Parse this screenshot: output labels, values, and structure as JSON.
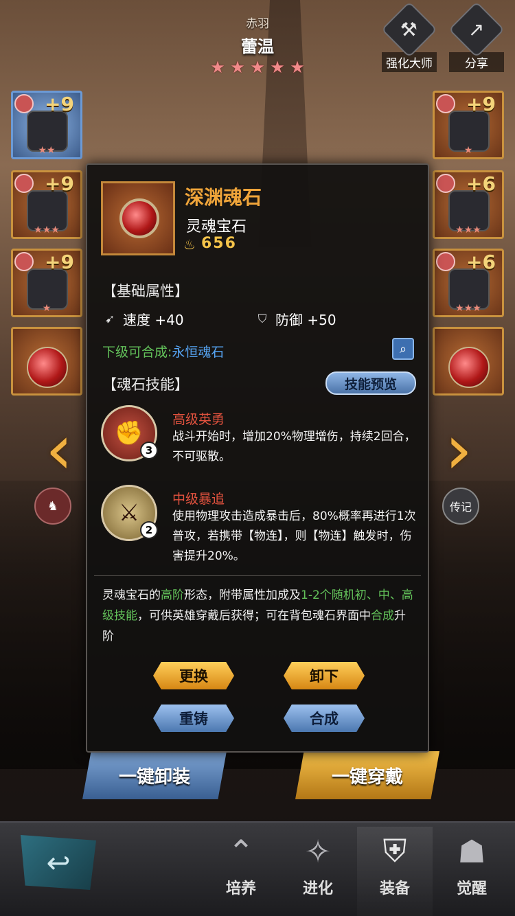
{
  "header": {
    "hero_subtitle": "赤羽",
    "hero_name": "蕾温",
    "star_count": 5,
    "star_glyph": "★",
    "enhance_master_label": "强化大师",
    "share_label": "分享"
  },
  "slots": {
    "left": [
      {
        "plus": "+9",
        "stars": "★★"
      },
      {
        "plus": "+9",
        "stars": "★★★"
      },
      {
        "plus": "+9",
        "stars": "★"
      },
      {
        "plus": "",
        "stars": ""
      }
    ],
    "right": [
      {
        "plus": "+9",
        "stars": "★"
      },
      {
        "plus": "+6",
        "stars": "★★★"
      },
      {
        "plus": "+6",
        "stars": "★★★"
      },
      {
        "plus": "",
        "stars": ""
      }
    ]
  },
  "side": {
    "left_arrow": "‹",
    "right_arrow": "›",
    "biography_label": "传记"
  },
  "popup": {
    "item_name": "深渊魂石",
    "item_type": "灵魂宝石",
    "power": "656",
    "base_attr_title": "【基础属性】",
    "attrs": [
      {
        "label": "速度 +40",
        "icon": "speed-icon"
      },
      {
        "label": "防御 +50",
        "icon": "shield-icon"
      }
    ],
    "synth_label": "下级可合成:",
    "synth_target": "永恒魂石",
    "skills_title": "【魂石技能】",
    "preview_label": "技能预览",
    "skills": [
      {
        "name": "高级英勇",
        "level": "3",
        "desc": "战斗开始时，增加20%物理增伤，持续2回合，不可驱散。"
      },
      {
        "name": "中级暴追",
        "level": "2",
        "desc": "使用物理攻击造成暴击后，80%概率再进行1次普攻，若携带【物连】，则【物连】触发时，伤害提升20%。"
      }
    ],
    "description": {
      "p1": "灵魂宝石的",
      "g1": "高阶",
      "p2": "形态，附带属性加成及",
      "g2": "1-2个随机初、中、高级技能",
      "p3": "，可供英雄穿戴后获得；可在背包魂石界面中",
      "g3": "合成",
      "p4": "升阶"
    },
    "buttons": {
      "replace": "更换",
      "unequip": "卸下",
      "recast": "重铸",
      "combine": "合成"
    }
  },
  "bottom": {
    "unequip_all": "一键卸装",
    "equip_all": "一键穿戴",
    "nav": [
      "培养",
      "进化",
      "装备",
      "觉醒"
    ],
    "active_index": 2
  }
}
